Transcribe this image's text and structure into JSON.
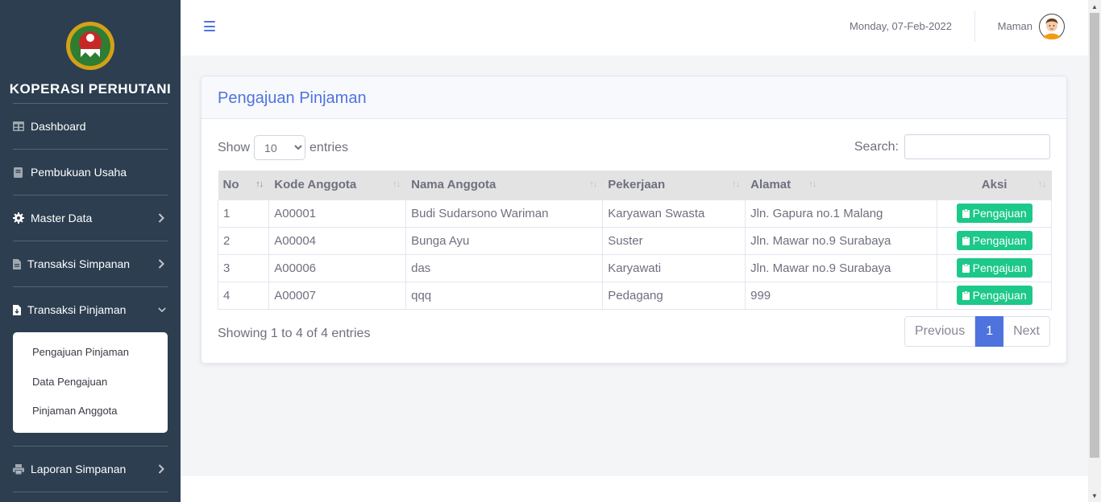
{
  "brand": {
    "name": "KOPERASI PERHUTANI"
  },
  "sidebar": {
    "items": [
      {
        "label": "Dashboard",
        "icon": "table-icon"
      },
      {
        "label": "Pembukuan Usaha",
        "icon": "book-icon"
      },
      {
        "label": "Master Data",
        "icon": "gear-icon"
      },
      {
        "label": "Transaksi Simpanan",
        "icon": "file-icon"
      },
      {
        "label": "Transaksi Pinjaman",
        "icon": "file-download-icon"
      },
      {
        "label": "Laporan Simpanan",
        "icon": "printer-icon"
      }
    ],
    "submenu": [
      "Pengajuan Pinjaman",
      "Data Pengajuan",
      "Pinjaman Anggota"
    ]
  },
  "topbar": {
    "date": "Monday, 07-Feb-2022",
    "user": "Maman"
  },
  "card": {
    "title": "Pengajuan Pinjaman",
    "show_label": "Show",
    "entries_label": "entries",
    "length_value": "10",
    "search_label": "Search:",
    "search_value": ""
  },
  "table": {
    "headers": [
      "No",
      "Kode Anggota",
      "Nama Anggota",
      "Pekerjaan",
      "Alamat",
      "Aksi"
    ],
    "rows": [
      {
        "no": "1",
        "kode": "A00001",
        "nama": "Budi Sudarsono Wariman",
        "pekerjaan": "Karyawan Swasta",
        "alamat": "Jln. Gapura no.1 Malang",
        "aksi": "Pengajuan"
      },
      {
        "no": "2",
        "kode": "A00004",
        "nama": "Bunga Ayu",
        "pekerjaan": "Suster",
        "alamat": "Jln. Mawar no.9 Surabaya",
        "aksi": "Pengajuan"
      },
      {
        "no": "3",
        "kode": "A00006",
        "nama": "das",
        "pekerjaan": "Karyawati",
        "alamat": "Jln. Mawar no.9 Surabaya",
        "aksi": "Pengajuan"
      },
      {
        "no": "4",
        "kode": "A00007",
        "nama": "qqq",
        "pekerjaan": "Pedagang",
        "alamat": "999",
        "aksi": "Pengajuan"
      }
    ]
  },
  "footer_info": "Showing 1 to 4 of 4 entries",
  "pagination": {
    "previous": "Previous",
    "current": "1",
    "next": "Next"
  },
  "colors": {
    "sidebar": "#2c3e50",
    "primary": "#4e73df",
    "success": "#1cc88a"
  }
}
